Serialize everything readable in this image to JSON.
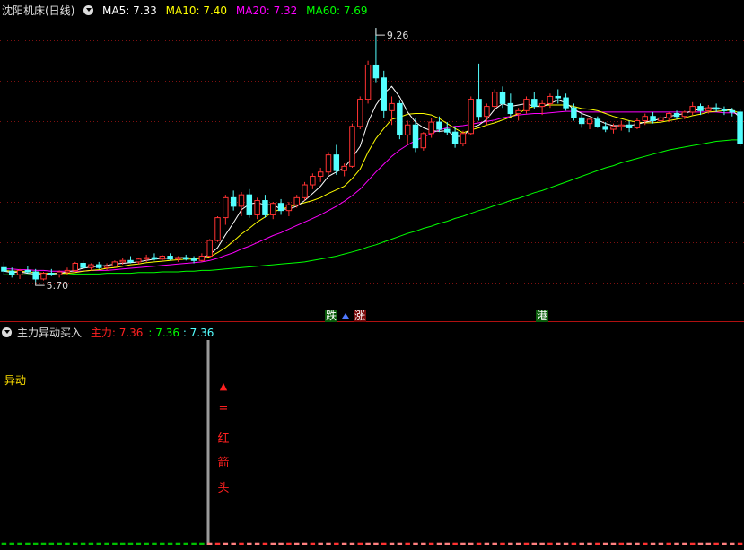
{
  "header": {
    "stock_name": "沈阳机床(日线)",
    "ma5_label": "MA5: 7.33",
    "ma10_label": "MA10: 7.40",
    "ma20_label": "MA20: 7.32",
    "ma60_label": "MA60: 7.69"
  },
  "sub_header": {
    "indicator_name": "主力异动买入",
    "main_force_label": "主力: 7.36",
    "value2": ": 7.36",
    "value3": ": 7.36"
  },
  "sub_side_label": "异动",
  "arrow_annotation": [
    "▲",
    "=",
    "红",
    "箭",
    "头"
  ],
  "event_tags": [
    "跌",
    "涨",
    "港"
  ],
  "colors": {
    "up": "#ff3232",
    "down": "#54ffff",
    "ma5": "#ffffff",
    "ma10": "#ffff00",
    "ma20": "#ff00ff",
    "ma60": "#00ff00",
    "grid": "#801010"
  },
  "chart_data": {
    "type": "candlestick",
    "ylim": [
      5.4,
      9.4
    ],
    "high_label": "9.26",
    "low_label": "5.70",
    "candles": [
      [
        5.9,
        5.98,
        5.8,
        5.85
      ],
      [
        5.85,
        5.9,
        5.76,
        5.8
      ],
      [
        5.8,
        5.88,
        5.74,
        5.86
      ],
      [
        5.86,
        5.92,
        5.82,
        5.84
      ],
      [
        5.84,
        5.88,
        5.7,
        5.74
      ],
      [
        5.74,
        5.84,
        5.72,
        5.82
      ],
      [
        5.82,
        5.88,
        5.78,
        5.8
      ],
      [
        5.8,
        5.86,
        5.76,
        5.84
      ],
      [
        5.84,
        5.9,
        5.8,
        5.86
      ],
      [
        5.86,
        5.98,
        5.84,
        5.96
      ],
      [
        5.96,
        6.0,
        5.88,
        5.9
      ],
      [
        5.9,
        5.96,
        5.86,
        5.94
      ],
      [
        5.94,
        5.98,
        5.88,
        5.9
      ],
      [
        5.9,
        5.96,
        5.86,
        5.92
      ],
      [
        5.92,
        6.0,
        5.9,
        5.98
      ],
      [
        5.98,
        6.04,
        5.94,
        6.0
      ],
      [
        6.0,
        6.06,
        5.96,
        5.98
      ],
      [
        5.98,
        6.04,
        5.94,
        6.02
      ],
      [
        6.02,
        6.08,
        5.98,
        6.04
      ],
      [
        6.04,
        6.1,
        6.0,
        6.02
      ],
      [
        6.02,
        6.08,
        5.98,
        6.06
      ],
      [
        6.06,
        6.1,
        6.0,
        6.02
      ],
      [
        6.02,
        6.06,
        5.98,
        6.04
      ],
      [
        6.04,
        6.08,
        6.0,
        6.02
      ],
      [
        6.02,
        6.06,
        5.96,
        6.0
      ],
      [
        6.0,
        6.1,
        5.98,
        6.06
      ],
      [
        6.06,
        6.3,
        6.04,
        6.28
      ],
      [
        6.28,
        6.62,
        6.26,
        6.6
      ],
      [
        6.6,
        6.92,
        6.5,
        6.88
      ],
      [
        6.88,
        6.98,
        6.7,
        6.76
      ],
      [
        6.76,
        6.96,
        6.62,
        6.92
      ],
      [
        6.92,
        7.0,
        6.6,
        6.64
      ],
      [
        6.64,
        6.88,
        6.58,
        6.84
      ],
      [
        6.84,
        6.92,
        6.6,
        6.64
      ],
      [
        6.64,
        6.82,
        6.58,
        6.8
      ],
      [
        6.8,
        6.86,
        6.64,
        6.7
      ],
      [
        6.7,
        6.82,
        6.62,
        6.78
      ],
      [
        6.78,
        6.92,
        6.74,
        6.88
      ],
      [
        6.88,
        7.1,
        6.84,
        7.06
      ],
      [
        7.06,
        7.22,
        7.0,
        7.18
      ],
      [
        7.18,
        7.3,
        7.1,
        7.24
      ],
      [
        7.24,
        7.52,
        7.2,
        7.48
      ],
      [
        7.48,
        7.62,
        7.2,
        7.26
      ],
      [
        7.26,
        7.36,
        7.18,
        7.32
      ],
      [
        7.32,
        7.92,
        7.3,
        7.88
      ],
      [
        7.88,
        8.3,
        7.84,
        8.26
      ],
      [
        8.26,
        8.8,
        8.2,
        8.74
      ],
      [
        8.74,
        9.26,
        8.5,
        8.56
      ],
      [
        8.56,
        8.66,
        8.0,
        8.1
      ],
      [
        8.1,
        8.3,
        7.9,
        8.2
      ],
      [
        8.2,
        8.24,
        7.7,
        7.76
      ],
      [
        7.76,
        7.96,
        7.62,
        7.9
      ],
      [
        7.9,
        8.0,
        7.52,
        7.58
      ],
      [
        7.58,
        7.8,
        7.54,
        7.78
      ],
      [
        7.78,
        8.0,
        7.72,
        7.94
      ],
      [
        7.94,
        8.02,
        7.8,
        7.84
      ],
      [
        7.84,
        7.94,
        7.76,
        7.8
      ],
      [
        7.8,
        7.88,
        7.58,
        7.64
      ],
      [
        7.64,
        7.82,
        7.6,
        7.78
      ],
      [
        7.78,
        8.3,
        7.76,
        8.26
      ],
      [
        8.26,
        8.76,
        7.96,
        8.02
      ],
      [
        8.02,
        8.2,
        7.9,
        8.16
      ],
      [
        8.16,
        8.4,
        8.1,
        8.36
      ],
      [
        8.36,
        8.44,
        8.14,
        8.2
      ],
      [
        8.2,
        8.34,
        8.02,
        8.06
      ],
      [
        8.06,
        8.14,
        7.96,
        8.1
      ],
      [
        8.1,
        8.3,
        8.06,
        8.26
      ],
      [
        8.26,
        8.36,
        8.12,
        8.16
      ],
      [
        8.16,
        8.24,
        8.04,
        8.2
      ],
      [
        8.2,
        8.34,
        8.14,
        8.3
      ],
      [
        8.3,
        8.4,
        8.2,
        8.28
      ],
      [
        8.28,
        8.34,
        8.1,
        8.14
      ],
      [
        8.14,
        8.2,
        7.96,
        8.0
      ],
      [
        8.0,
        8.06,
        7.86,
        7.92
      ],
      [
        7.92,
        8.0,
        7.84,
        7.98
      ],
      [
        7.98,
        8.02,
        7.86,
        7.88
      ],
      [
        7.88,
        7.94,
        7.8,
        7.84
      ],
      [
        7.84,
        7.92,
        7.78,
        7.88
      ],
      [
        7.88,
        7.96,
        7.82,
        7.9
      ],
      [
        7.9,
        7.96,
        7.8,
        7.86
      ],
      [
        7.86,
        8.0,
        7.84,
        7.96
      ],
      [
        7.96,
        8.06,
        7.9,
        8.02
      ],
      [
        8.02,
        8.08,
        7.92,
        7.96
      ],
      [
        7.96,
        8.04,
        7.92,
        8.0
      ],
      [
        8.0,
        8.08,
        7.94,
        8.06
      ],
      [
        8.06,
        8.1,
        7.98,
        8.02
      ],
      [
        8.02,
        8.1,
        7.98,
        8.08
      ],
      [
        8.08,
        8.22,
        8.04,
        8.16
      ],
      [
        8.16,
        8.2,
        8.04,
        8.1
      ],
      [
        8.1,
        8.18,
        8.06,
        8.14
      ],
      [
        8.14,
        8.2,
        8.08,
        8.12
      ],
      [
        8.12,
        8.16,
        8.04,
        8.1
      ],
      [
        8.1,
        8.14,
        8.02,
        8.08
      ],
      [
        8.08,
        8.12,
        7.6,
        7.64
      ]
    ],
    "ma_values": {
      "ma5": [
        5.85,
        5.83,
        5.84,
        5.82,
        5.81,
        5.8,
        5.81,
        5.82,
        5.84,
        5.86,
        5.89,
        5.91,
        5.92,
        5.93,
        5.95,
        5.96,
        5.97,
        5.98,
        6.0,
        6.02,
        6.03,
        6.03,
        6.04,
        6.04,
        6.03,
        6.04,
        6.08,
        6.18,
        6.36,
        6.53,
        6.71,
        6.79,
        6.81,
        6.78,
        6.78,
        6.72,
        6.72,
        6.76,
        6.84,
        6.94,
        7.04,
        7.18,
        7.24,
        7.3,
        7.44,
        7.6,
        7.94,
        8.18,
        8.34,
        8.44,
        8.29,
        8.08,
        7.94,
        7.86,
        7.82,
        7.81,
        7.82,
        7.74,
        7.74,
        7.86,
        7.9,
        7.98,
        8.12,
        8.2,
        8.16,
        8.18,
        8.2,
        8.16,
        8.16,
        8.2,
        8.25,
        8.21,
        8.12,
        8.06,
        8.02,
        7.97,
        7.92,
        7.89,
        7.89,
        7.89,
        7.91,
        7.94,
        7.96,
        7.99,
        8.02,
        8.04,
        8.06,
        8.1,
        8.12,
        8.14,
        8.14,
        8.12,
        8.11,
        8.0
      ],
      "ma10": [
        5.86,
        5.85,
        5.85,
        5.84,
        5.83,
        5.82,
        5.82,
        5.82,
        5.82,
        5.83,
        5.85,
        5.86,
        5.87,
        5.89,
        5.9,
        5.92,
        5.94,
        5.95,
        5.97,
        5.98,
        5.99,
        6.0,
        6.01,
        6.02,
        6.02,
        6.03,
        6.05,
        6.11,
        6.18,
        6.27,
        6.37,
        6.45,
        6.54,
        6.61,
        6.68,
        6.72,
        6.75,
        6.78,
        6.81,
        6.84,
        6.88,
        6.94,
        6.99,
        7.04,
        7.15,
        7.28,
        7.52,
        7.71,
        7.85,
        7.98,
        8.01,
        8.05,
        8.06,
        8.06,
        8.04,
        7.99,
        7.92,
        7.85,
        7.79,
        7.83,
        7.86,
        7.9,
        7.93,
        7.97,
        8.01,
        8.06,
        8.13,
        8.16,
        8.17,
        8.18,
        8.18,
        8.18,
        8.16,
        8.13,
        8.12,
        8.1,
        8.06,
        8.02,
        7.99,
        7.96,
        7.94,
        7.93,
        7.93,
        7.94,
        7.96,
        7.98,
        8.0,
        8.03,
        8.05,
        8.08,
        8.09,
        8.1,
        8.11,
        8.06
      ],
      "ma20": [
        5.88,
        5.88,
        5.87,
        5.87,
        5.86,
        5.86,
        5.85,
        5.85,
        5.85,
        5.85,
        5.85,
        5.86,
        5.86,
        5.86,
        5.87,
        5.88,
        5.89,
        5.9,
        5.91,
        5.92,
        5.93,
        5.94,
        5.95,
        5.96,
        5.97,
        5.98,
        6.0,
        6.03,
        6.07,
        6.11,
        6.16,
        6.2,
        6.25,
        6.3,
        6.35,
        6.39,
        6.44,
        6.49,
        6.54,
        6.59,
        6.64,
        6.7,
        6.76,
        6.83,
        6.91,
        7.0,
        7.12,
        7.24,
        7.35,
        7.46,
        7.55,
        7.62,
        7.68,
        7.73,
        7.78,
        7.83,
        7.86,
        7.88,
        7.89,
        7.91,
        7.93,
        7.95,
        7.97,
        8.0,
        8.02,
        8.04,
        8.05,
        8.06,
        8.06,
        8.07,
        8.08,
        8.09,
        8.09,
        8.08,
        8.08,
        8.08,
        8.08,
        8.08,
        8.08,
        8.08,
        8.08,
        8.08,
        8.08,
        8.08,
        8.08,
        8.08,
        8.08,
        8.08,
        8.08,
        8.08,
        8.08,
        8.07,
        8.07,
        8.05
      ],
      "ma60": [
        5.8,
        5.8,
        5.8,
        5.8,
        5.8,
        5.8,
        5.8,
        5.8,
        5.8,
        5.81,
        5.81,
        5.81,
        5.81,
        5.82,
        5.82,
        5.82,
        5.82,
        5.83,
        5.83,
        5.83,
        5.84,
        5.84,
        5.84,
        5.85,
        5.85,
        5.86,
        5.86,
        5.87,
        5.88,
        5.89,
        5.9,
        5.91,
        5.92,
        5.93,
        5.94,
        5.95,
        5.96,
        5.97,
        5.98,
        6.0,
        6.02,
        6.04,
        6.06,
        6.09,
        6.12,
        6.15,
        6.19,
        6.22,
        6.26,
        6.3,
        6.34,
        6.38,
        6.41,
        6.45,
        6.48,
        6.52,
        6.55,
        6.59,
        6.62,
        6.66,
        6.7,
        6.73,
        6.77,
        6.8,
        6.84,
        6.87,
        6.91,
        6.95,
        6.98,
        7.02,
        7.06,
        7.1,
        7.14,
        7.18,
        7.22,
        7.26,
        7.3,
        7.33,
        7.37,
        7.4,
        7.43,
        7.46,
        7.49,
        7.52,
        7.55,
        7.57,
        7.59,
        7.61,
        7.63,
        7.65,
        7.67,
        7.68,
        7.69,
        7.69
      ]
    },
    "sub_ylim": [
      0,
      100
    ],
    "sub_bars_values": [
      1,
      1,
      1,
      1,
      1,
      1,
      1,
      1,
      1,
      1,
      1,
      1,
      1,
      1,
      1,
      1,
      1,
      1,
      1,
      1,
      1,
      1,
      1,
      1,
      1,
      1,
      1,
      1,
      1,
      1,
      1,
      1,
      1,
      1,
      1,
      1,
      1,
      1,
      1,
      1,
      1,
      1,
      1,
      1,
      1,
      1,
      1,
      1,
      1,
      1,
      1,
      1,
      1,
      1,
      1,
      1,
      1,
      1,
      1,
      1,
      1,
      1,
      1,
      1,
      1,
      1,
      1,
      1,
      1,
      1,
      1,
      1,
      1,
      1,
      1,
      1,
      1,
      1,
      1,
      1,
      1,
      1,
      1,
      1,
      1,
      1,
      1,
      1,
      1,
      1,
      1,
      1,
      1,
      1
    ]
  }
}
